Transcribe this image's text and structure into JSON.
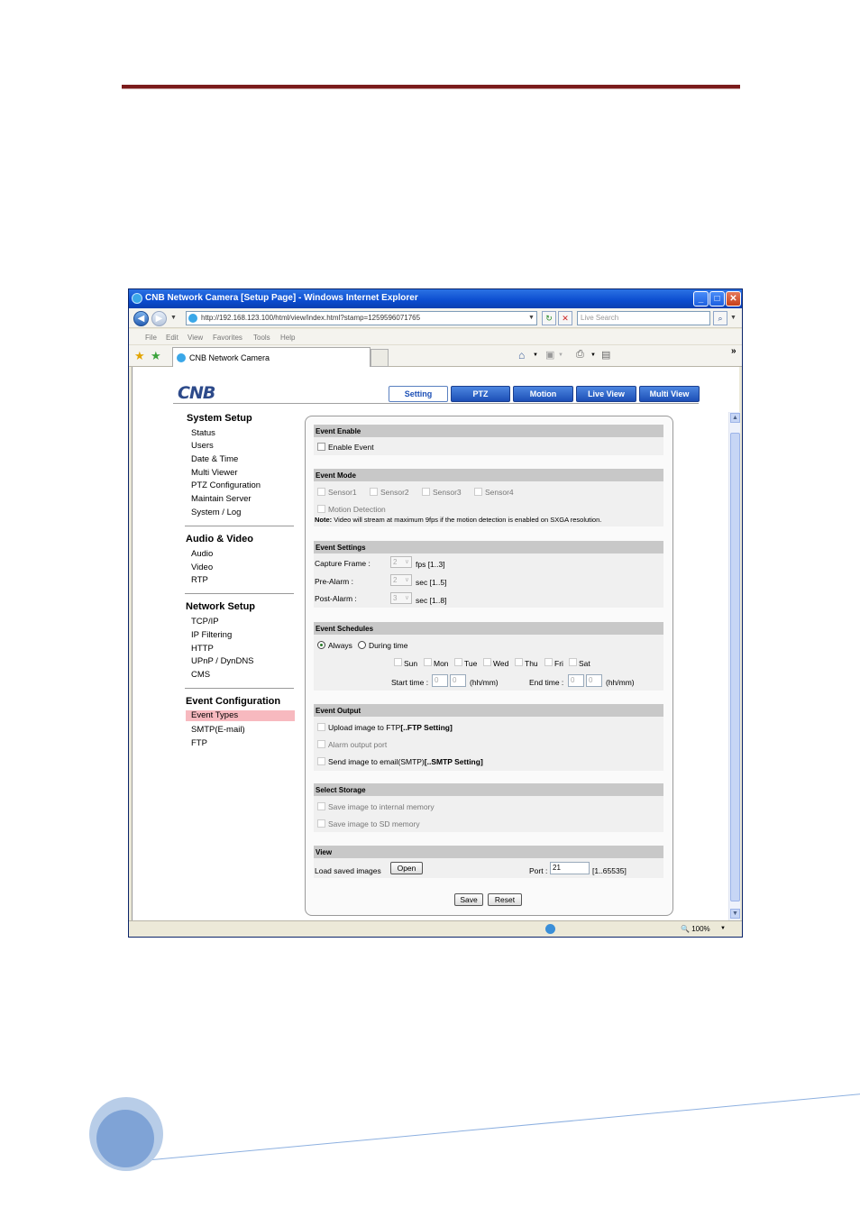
{
  "browser": {
    "title": "CNB Network Camera [Setup Page] - Windows Internet Explorer",
    "address": "http://192.168.123.100/html/view/index.html?stamp=1259596071765",
    "search_placeholder": "Live Search",
    "menu": [
      "File",
      "Edit",
      "View",
      "Favorites",
      "Tools",
      "Help"
    ],
    "tab_label": "CNB Network Camera",
    "zoom": "100%",
    "overflow": "»"
  },
  "logo": "CNB",
  "topnav": [
    {
      "label": "Setting",
      "active": true
    },
    {
      "label": "PTZ",
      "active": false
    },
    {
      "label": "Motion",
      "active": false
    },
    {
      "label": "Live View",
      "active": false
    },
    {
      "label": "Multi View",
      "active": false
    }
  ],
  "sidebar": {
    "system": {
      "title": "System Setup",
      "items": [
        "Status",
        "Users",
        "Date & Time",
        "Multi Viewer",
        "PTZ Configuration",
        "Maintain Server",
        "System / Log"
      ]
    },
    "av": {
      "title": "Audio & Video",
      "items": [
        "Audio",
        "Video",
        "RTP"
      ]
    },
    "network": {
      "title": "Network Setup",
      "items": [
        "TCP/IP",
        "IP Filtering",
        "HTTP",
        "UPnP / DynDNS",
        "CMS"
      ]
    },
    "event": {
      "title": "Event Configuration",
      "items": [
        "Event Types",
        "SMTP(E-mail)",
        "FTP"
      ],
      "selected": "Event Types"
    }
  },
  "event_enable": {
    "title": "Event Enable",
    "label": "Enable Event"
  },
  "event_mode": {
    "title": "Event Mode",
    "sensors": [
      "Sensor1",
      "Sensor2",
      "Sensor3",
      "Sensor4"
    ],
    "motion": "Motion Detection",
    "note_prefix": "Note:",
    "note": " Video will stream at maximum 9fps if the motion detection is enabled on SXGA resolution."
  },
  "event_settings": {
    "title": "Event Settings",
    "rows": [
      {
        "label": "Capture Frame :",
        "value": "2",
        "unit": "fps [1..3]"
      },
      {
        "label": "Pre-Alarm :",
        "value": "2",
        "unit": "sec [1..5]"
      },
      {
        "label": "Post-Alarm :",
        "value": "3",
        "unit": "sec [1..8]"
      }
    ]
  },
  "event_schedules": {
    "title": "Event Schedules",
    "always": "Always",
    "during": "During time",
    "days": [
      "Sun",
      "Mon",
      "Tue",
      "Wed",
      "Thu",
      "Fri",
      "Sat"
    ],
    "start_label": "Start time :",
    "end_label": "End time :",
    "start_h": "0",
    "start_m": "0",
    "end_h": "0",
    "end_m": "0",
    "format": "(hh/mm)"
  },
  "event_output": {
    "title": "Event Output",
    "ftp_text": "Upload image to FTP",
    "ftp_link": "[..FTP Setting]",
    "alarm": "Alarm output port",
    "smtp_text": "Send image to email(SMTP)",
    "smtp_link": "[..SMTP Setting]"
  },
  "storage": {
    "title": "Select Storage",
    "internal": "Save image to internal memory",
    "sd": "Save image to SD memory"
  },
  "view": {
    "title": "View",
    "load_label": "Load saved images",
    "open": "Open",
    "port_label": "Port :",
    "port_value": "21",
    "port_range": "[1..65535]"
  },
  "actions": {
    "save": "Save",
    "reset": "Reset"
  }
}
